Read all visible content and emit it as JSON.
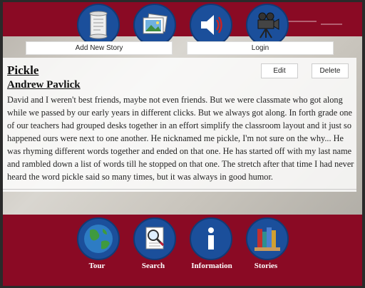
{
  "toolbar": {
    "add_story_label": "Add New Story",
    "login_label": "Login",
    "icons": [
      "scroll-icon",
      "photos-icon",
      "speaker-icon",
      "movie-camera-icon"
    ]
  },
  "story": {
    "title": "Pickle",
    "author": "Andrew Pavlick",
    "edit_label": "Edit",
    "delete_label": "Delete",
    "text": "David and I weren't best friends, maybe not even friends. But we were classmate who got along while we passed by our early years in different clicks. But we always got along. In forth grade one of our teachers had grouped desks together in an effort simplify the classroom layout and it just so happened ours were next to one another. He nicknamed me pickle, I'm not sure on the why... He was rhyming different words together and ended on that one. He has started off with my last name and rambled down a list of words till he stopped on that one. The stretch after that time I had never heard the word pickle said so many times, but it was always in good humor."
  },
  "nav": {
    "tour_label": "Tour",
    "search_label": "Search",
    "information_label": "Information",
    "stories_label": "Stories"
  },
  "colors": {
    "bar": "#8a0a24",
    "icon_circle": "#1b4f9b"
  }
}
